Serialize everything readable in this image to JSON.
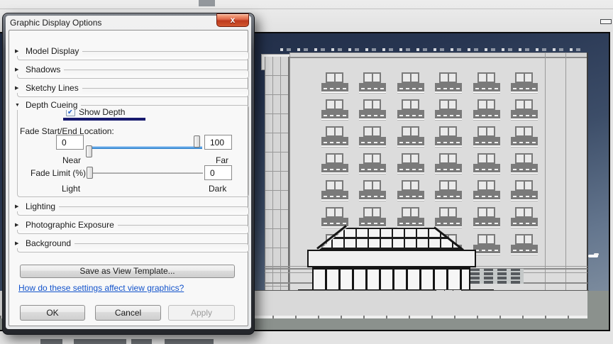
{
  "dialog": {
    "title": "Graphic Display Options",
    "sections": [
      {
        "label": "Model Display",
        "state": "collapsed"
      },
      {
        "label": "Shadows",
        "state": "collapsed"
      },
      {
        "label": "Sketchy Lines",
        "state": "collapsed"
      },
      {
        "label": "Depth Cueing",
        "state": "expanded"
      },
      {
        "label": "Lighting",
        "state": "collapsed"
      },
      {
        "label": "Photographic Exposure",
        "state": "collapsed"
      },
      {
        "label": "Background",
        "state": "collapsed"
      }
    ],
    "depth_cueing": {
      "show_depth_label": "Show Depth",
      "show_depth_checked": true,
      "fade_location_label": "Fade Start/End Location:",
      "near_value": "0",
      "far_value": "100",
      "near_label": "Near",
      "far_label": "Far",
      "fade_limit_label": "Fade Limit (%):",
      "fade_limit_value": "0",
      "light_label": "Light",
      "dark_label": "Dark"
    },
    "save_template_button": "Save as View Template...",
    "help_link": "How do these settings affect view graphics?",
    "ok_button": "OK",
    "cancel_button": "Cancel",
    "apply_button": "Apply",
    "apply_enabled": false
  },
  "icons": {
    "close": "x",
    "check": "✓",
    "collapsed_arrow": "▶",
    "expanded_arrow": "▼"
  },
  "colors": {
    "accent_slider_blue": "#57a2e6",
    "annotation_navy": "#181a6e",
    "link_blue": "#1353cb",
    "close_button_red": "#bd3a1e",
    "sky_top": "#1d2941",
    "sky_bottom": "#8997a6",
    "terrain_gray_green": "#8b918d",
    "facade_gray": "#dcdcdc",
    "window_frame_gray": "#7a7a7a"
  },
  "view": {
    "description": "3D elevation of residential building with balcony windows and entrance canopy",
    "window_rows": 7,
    "window_cols": 6
  }
}
